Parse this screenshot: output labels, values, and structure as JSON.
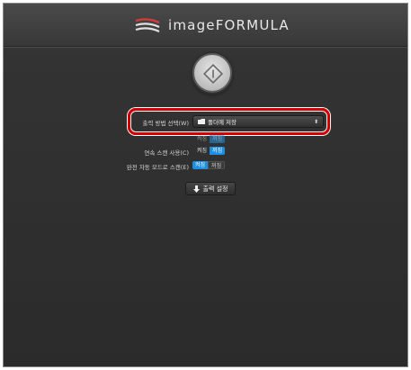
{
  "app": {
    "logo_text": "imageFORMULA"
  },
  "scan_button": {
    "icon": "scan-diamond-icon"
  },
  "settings": {
    "obscured_label": "",
    "obscured_value": "",
    "output_method": {
      "label": "출력 방법 선택(W)",
      "value": "폴더에 저장",
      "folder_icon": "folder-icon",
      "arrow_icon": "updown-arrow-icon"
    },
    "dim_row_label": "",
    "dim_row_toggle": {
      "on": "켜짐",
      "off": "꺼짐"
    },
    "continuous_scan": {
      "label": "연속 스캔 사용(C)",
      "on": "켜짐",
      "off": "꺼짐"
    },
    "auto_mode_scan": {
      "label": "완전 자동 모드로 스캔(E)",
      "on": "켜짐",
      "off": "꺼짐"
    }
  },
  "output_settings_button": {
    "label": "출력 설정",
    "icon": "download-arrow-icon"
  },
  "colors": {
    "highlight": "#d40000",
    "toggle_active": "#1e8fe0",
    "background": "#333333"
  }
}
